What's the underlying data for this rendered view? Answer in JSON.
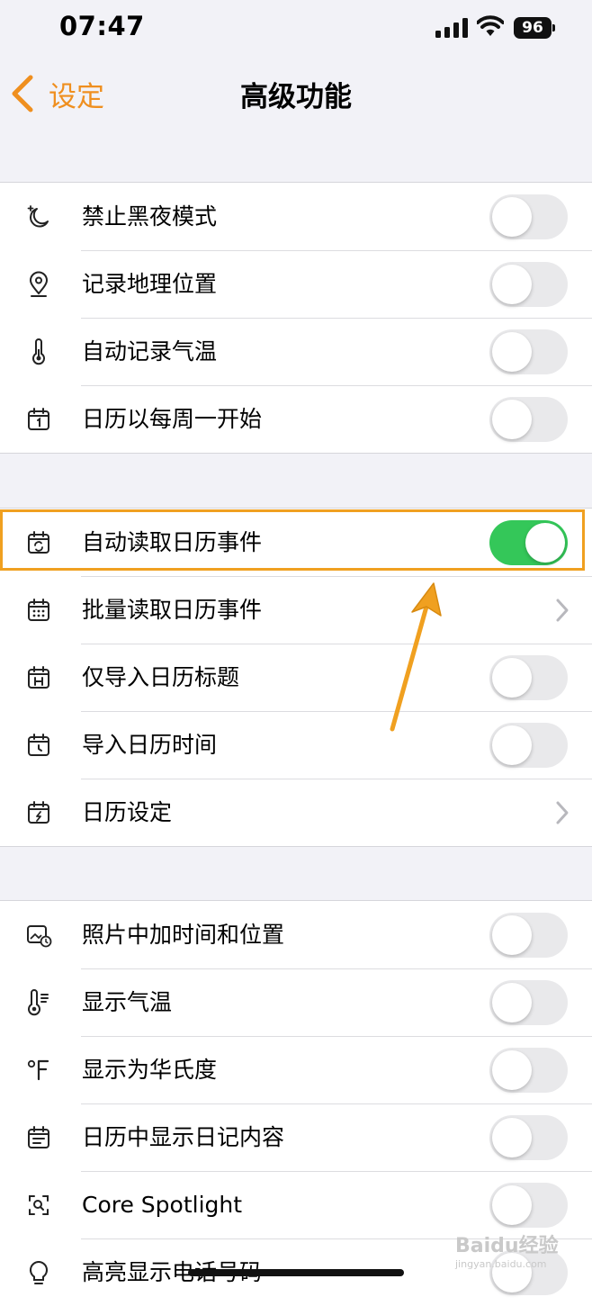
{
  "status_bar": {
    "time": "07:47",
    "battery": "96"
  },
  "nav": {
    "back_label": "设定",
    "title": "高级功能"
  },
  "groups": [
    {
      "rows": [
        {
          "icon": "moon-icon",
          "label": "禁止黑夜模式",
          "control": "toggle",
          "on": false
        },
        {
          "icon": "location-pin-icon",
          "label": "记录地理位置",
          "control": "toggle",
          "on": false
        },
        {
          "icon": "thermometer-icon",
          "label": "自动记录气温",
          "control": "toggle",
          "on": false
        },
        {
          "icon": "calendar-one-icon",
          "label": "日历以每周一开始",
          "control": "toggle",
          "on": false
        }
      ]
    },
    {
      "rows": [
        {
          "icon": "calendar-sync-icon",
          "label": "自动读取日历事件",
          "control": "toggle",
          "on": true
        },
        {
          "icon": "calendar-grid-icon",
          "label": "批量读取日历事件",
          "control": "chevron"
        },
        {
          "icon": "calendar-h-icon",
          "label": "仅导入日历标题",
          "control": "toggle",
          "on": false
        },
        {
          "icon": "calendar-clock-icon",
          "label": "导入日历时间",
          "control": "toggle",
          "on": false
        },
        {
          "icon": "calendar-settings-icon",
          "label": "日历设定",
          "control": "chevron"
        }
      ]
    },
    {
      "rows": [
        {
          "icon": "photo-clock-icon",
          "label": "照片中加时间和位置",
          "control": "toggle",
          "on": false
        },
        {
          "icon": "thermometer-lines-icon",
          "label": "显示气温",
          "control": "toggle",
          "on": false
        },
        {
          "icon": "fahrenheit-icon",
          "label": "显示为华氏度",
          "control": "toggle",
          "on": false
        },
        {
          "icon": "calendar-notes-icon",
          "label": "日历中显示日记内容",
          "control": "toggle",
          "on": false
        },
        {
          "icon": "spotlight-icon",
          "label": "Core Spotlight",
          "control": "toggle",
          "on": false
        },
        {
          "icon": "lightbulb-icon",
          "label": "高亮显示电话号码",
          "control": "toggle",
          "on": false
        }
      ]
    }
  ],
  "accent_color": "#ef8f1f",
  "toggle_on_color": "#34c759",
  "watermark": {
    "text": "Baidu经验",
    "sub": "jingyan.baidu.com"
  }
}
